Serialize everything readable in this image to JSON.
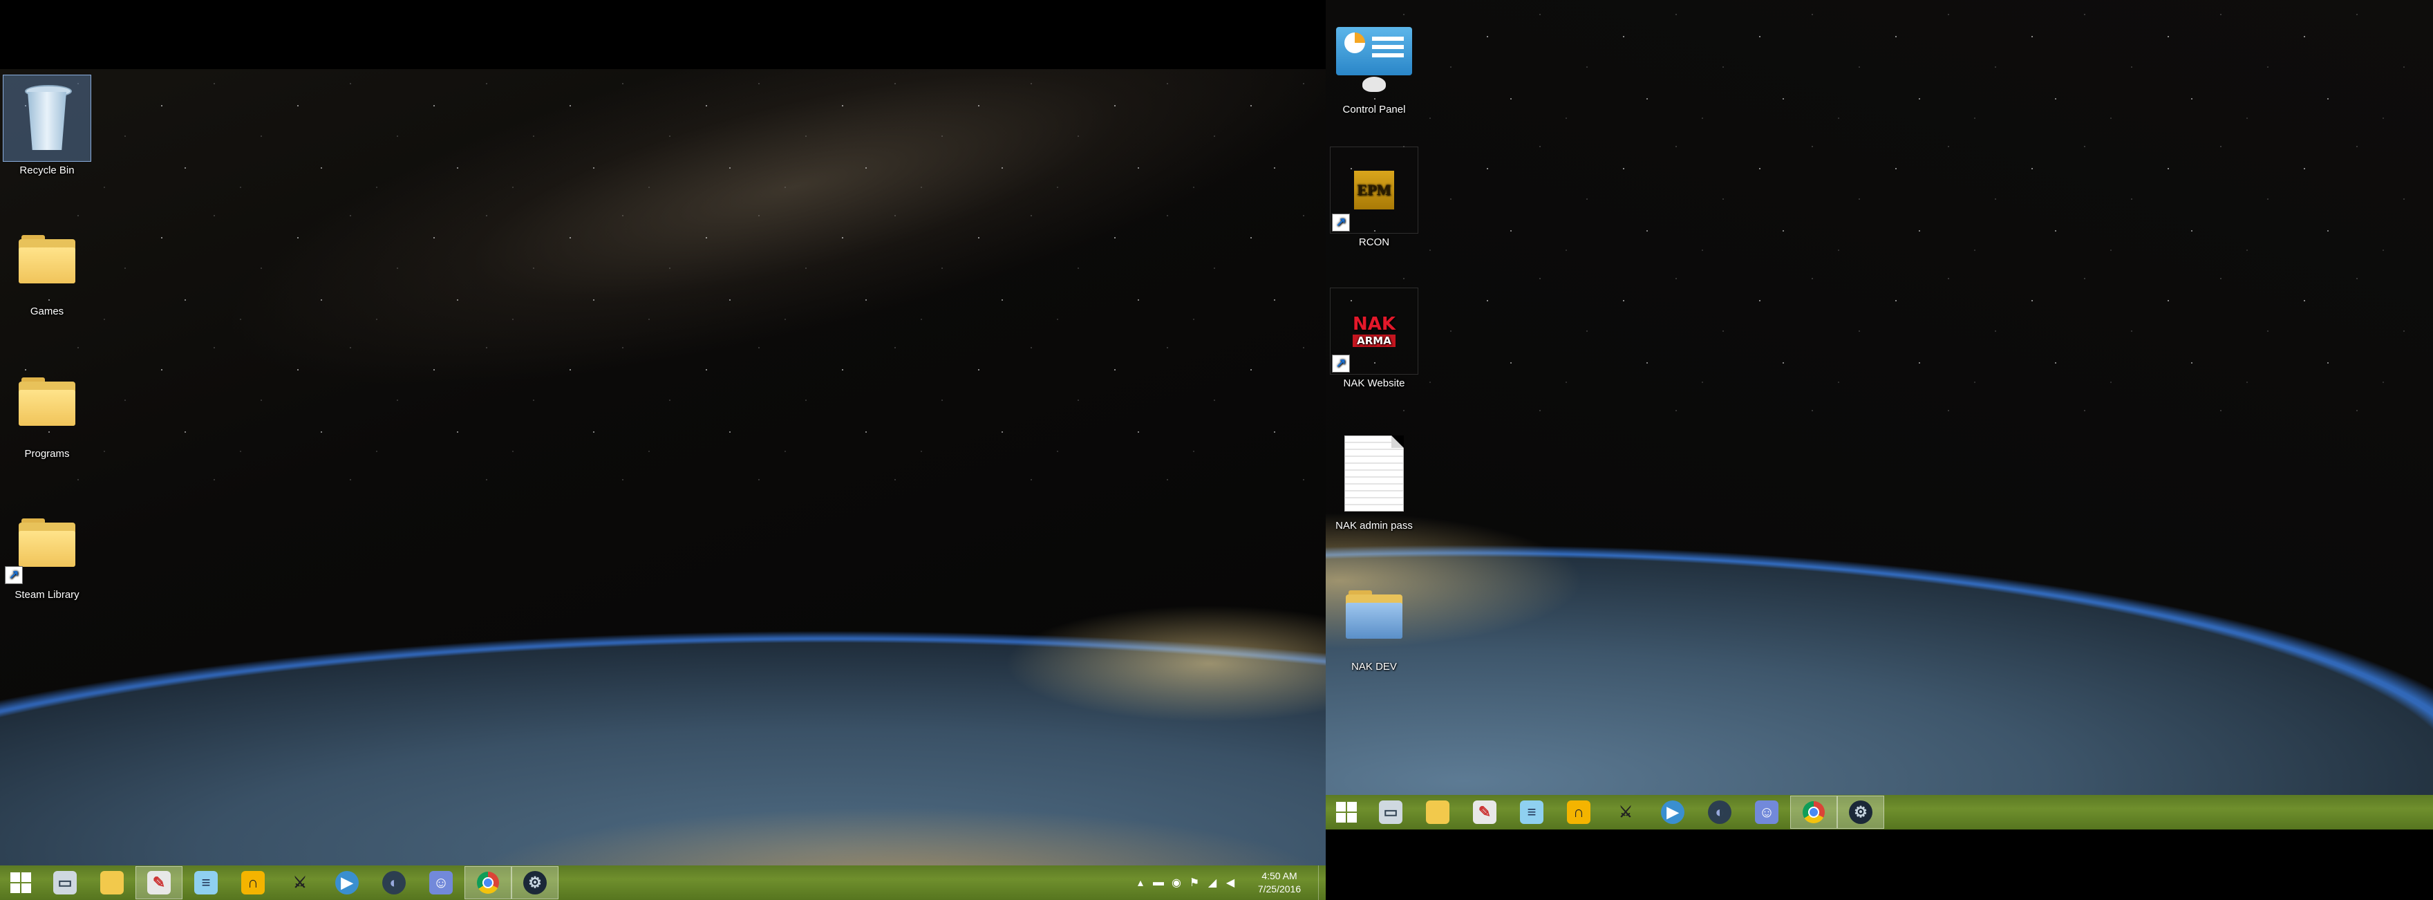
{
  "desktop_left": {
    "icons": [
      {
        "label": "Recycle Bin",
        "icon": "recycle-bin-icon",
        "selected": true
      },
      {
        "label": "Games",
        "icon": "folder-icon"
      },
      {
        "label": "Programs",
        "icon": "folder-icon"
      },
      {
        "label": "Steam Library",
        "icon": "folder-shortcut-icon"
      }
    ]
  },
  "desktop_right": {
    "icons": [
      {
        "label": "Control Panel",
        "icon": "control-panel-icon"
      },
      {
        "label": "RCON",
        "icon": "epm-rcon-icon",
        "glyph": "EPM"
      },
      {
        "label": "NAK Website",
        "icon": "nak-website-icon",
        "glyph": "NAK",
        "glyph_sub": "ARMA"
      },
      {
        "label": "NAK admin pass",
        "icon": "text-document-icon"
      },
      {
        "label": "NAK DEV",
        "icon": "folder-icon"
      }
    ]
  },
  "taskbar_left": {
    "apps": [
      {
        "name": "start-button",
        "icon": "windows-logo-icon"
      },
      {
        "name": "taskbar-this-pc",
        "icon": "computer-icon"
      },
      {
        "name": "taskbar-file-explorer",
        "icon": "folder-icon"
      },
      {
        "name": "taskbar-paint",
        "icon": "paint-icon",
        "active": true
      },
      {
        "name": "taskbar-notepad",
        "icon": "notepad-icon"
      },
      {
        "name": "taskbar-teamspeak",
        "icon": "headset-icon"
      },
      {
        "name": "taskbar-arma",
        "icon": "soldier-icon"
      },
      {
        "name": "taskbar-media-player",
        "icon": "play-icon"
      },
      {
        "name": "taskbar-app",
        "icon": "swirl-icon"
      },
      {
        "name": "taskbar-discord",
        "icon": "discord-icon"
      },
      {
        "name": "taskbar-chrome",
        "icon": "chrome-icon",
        "active": true
      },
      {
        "name": "taskbar-steam",
        "icon": "steam-icon",
        "active": true
      }
    ],
    "tray": {
      "time": "4:50 AM",
      "date": "7/25/2016",
      "icons": [
        "chevron-up-icon",
        "network-adapter-icon",
        "steam-tray-icon",
        "flag-icon",
        "signal-icon",
        "volume-icon"
      ]
    }
  },
  "taskbar_right": {
    "apps": [
      {
        "name": "start-button",
        "icon": "windows-logo-icon"
      },
      {
        "name": "taskbar-this-pc",
        "icon": "computer-icon"
      },
      {
        "name": "taskbar-file-explorer",
        "icon": "folder-icon"
      },
      {
        "name": "taskbar-paint",
        "icon": "paint-icon"
      },
      {
        "name": "taskbar-notepad",
        "icon": "notepad-icon"
      },
      {
        "name": "taskbar-teamspeak",
        "icon": "headset-icon"
      },
      {
        "name": "taskbar-arma",
        "icon": "soldier-icon"
      },
      {
        "name": "taskbar-media-player",
        "icon": "play-icon"
      },
      {
        "name": "taskbar-app",
        "icon": "swirl-icon"
      },
      {
        "name": "taskbar-discord",
        "icon": "discord-icon"
      },
      {
        "name": "taskbar-chrome",
        "icon": "chrome-icon",
        "active": true
      },
      {
        "name": "taskbar-steam",
        "icon": "steam-icon",
        "active": true
      }
    ]
  },
  "colors": {
    "taskbar": "#6f8f2d",
    "selection": "#78aae6"
  }
}
